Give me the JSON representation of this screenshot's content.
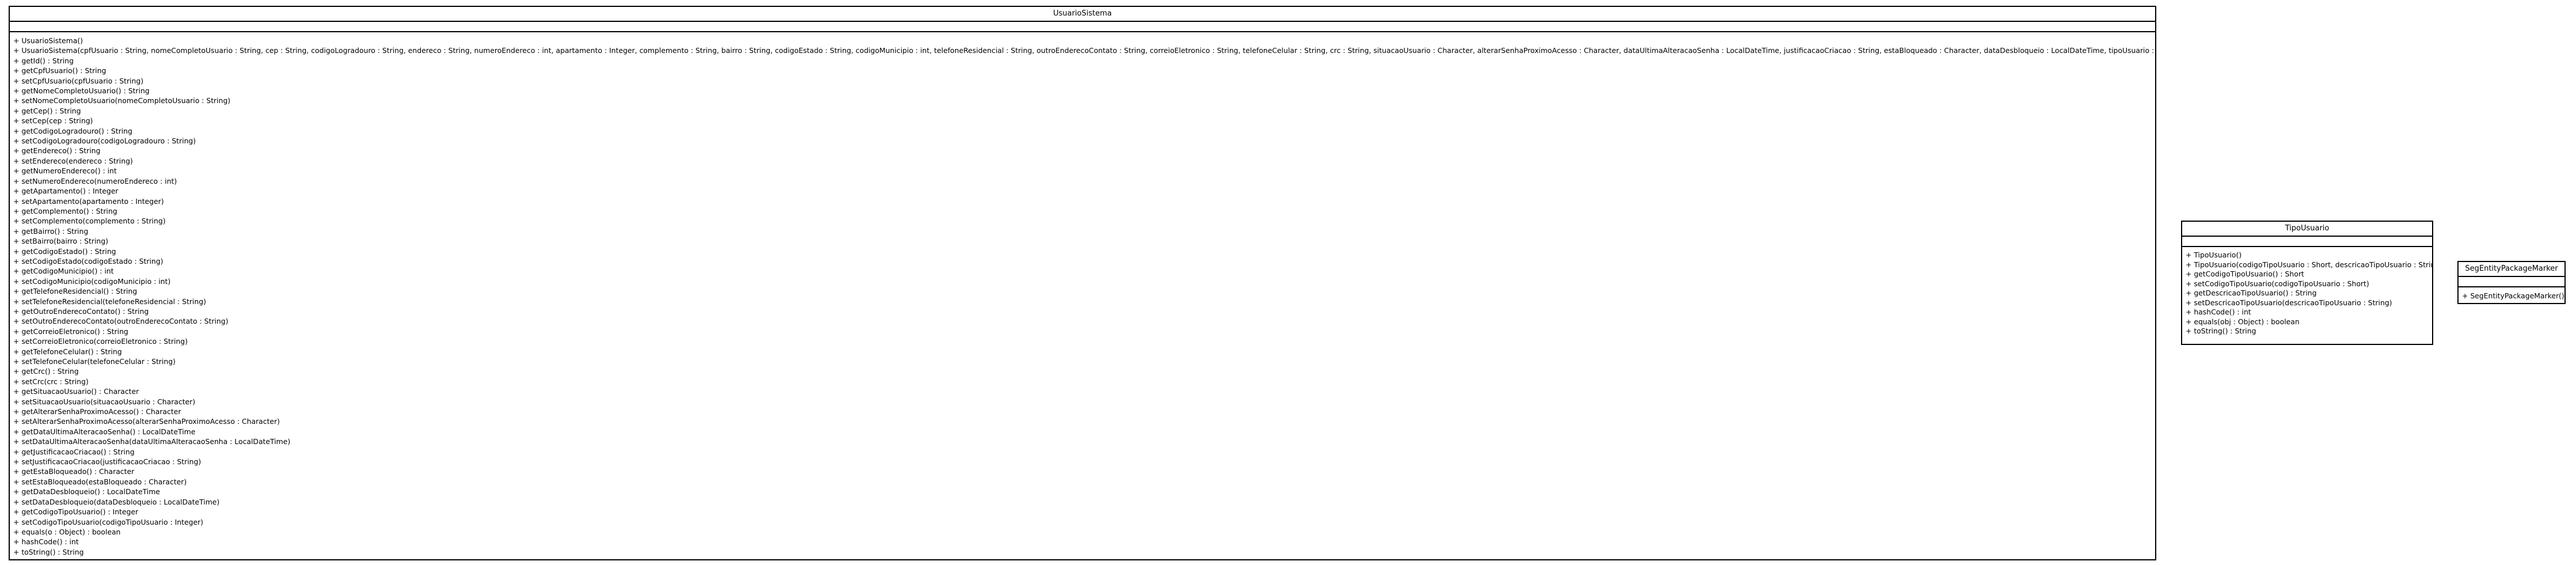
{
  "classes": {
    "usuario_sistema": {
      "name": "UsuarioSistema",
      "operations": [
        "+ UsuarioSistema()",
        "+ UsuarioSistema(cpfUsuario : String, nomeCompletoUsuario : String, cep : String, codigoLogradouro : String, endereco : String, numeroEndereco : int, apartamento : Integer, complemento : String, bairro : String, codigoEstado : String, codigoMunicipio : int, telefoneResidencial : String, outroEnderecoContato : String, correioEletronico : String, telefoneCelular : String, crc : String, situacaoUsuario : Character, alterarSenhaProximoAcesso : Character, dataUltimaAlteracaoSenha : LocalDateTime, justificacaoCriacao : String, estaBloqueado : Character, dataDesbloqueio : LocalDateTime, tipoUsuario : TipoUsuario, codigoTipoUsuario : Integer)",
        "+ getId() : String",
        "+ getCpfUsuario() : String",
        "+ setCpfUsuario(cpfUsuario : String)",
        "+ getNomeCompletoUsuario() : String",
        "+ setNomeCompletoUsuario(nomeCompletoUsuario : String)",
        "+ getCep() : String",
        "+ setCep(cep : String)",
        "+ getCodigoLogradouro() : String",
        "+ setCodigoLogradouro(codigoLogradouro : String)",
        "+ getEndereco() : String",
        "+ setEndereco(endereco : String)",
        "+ getNumeroEndereco() : int",
        "+ setNumeroEndereco(numeroEndereco : int)",
        "+ getApartamento() : Integer",
        "+ setApartamento(apartamento : Integer)",
        "+ getComplemento() : String",
        "+ setComplemento(complemento : String)",
        "+ getBairro() : String",
        "+ setBairro(bairro : String)",
        "+ getCodigoEstado() : String",
        "+ setCodigoEstado(codigoEstado : String)",
        "+ getCodigoMunicipio() : int",
        "+ setCodigoMunicipio(codigoMunicipio : int)",
        "+ getTelefoneResidencial() : String",
        "+ setTelefoneResidencial(telefoneResidencial : String)",
        "+ getOutroEnderecoContato() : String",
        "+ setOutroEnderecoContato(outroEnderecoContato : String)",
        "+ getCorreioEletronico() : String",
        "+ setCorreioEletronico(correioEletronico : String)",
        "+ getTelefoneCelular() : String",
        "+ setTelefoneCelular(telefoneCelular : String)",
        "+ getCrc() : String",
        "+ setCrc(crc : String)",
        "+ getSituacaoUsuario() : Character",
        "+ setSituacaoUsuario(situacaoUsuario : Character)",
        "+ getAlterarSenhaProximoAcesso() : Character",
        "+ setAlterarSenhaProximoAcesso(alterarSenhaProximoAcesso : Character)",
        "+ getDataUltimaAlteracaoSenha() : LocalDateTime",
        "+ setDataUltimaAlteracaoSenha(dataUltimaAlteracaoSenha : LocalDateTime)",
        "+ getJustificacaoCriacao() : String",
        "+ setJustificacaoCriacao(justificacaoCriacao : String)",
        "+ getEstaBloqueado() : Character",
        "+ setEstaBloqueado(estaBloqueado : Character)",
        "+ getDataDesbloqueio() : LocalDateTime",
        "+ setDataDesbloqueio(dataDesbloqueio : LocalDateTime)",
        "+ getCodigoTipoUsuario() : Integer",
        "+ setCodigoTipoUsuario(codigoTipoUsuario : Integer)",
        "+ equals(o : Object) : boolean",
        "+ hashCode() : int",
        "+ toString() : String"
      ]
    },
    "tipo_usuario": {
      "name": "TipoUsuario",
      "operations": [
        "+ TipoUsuario()",
        "+ TipoUsuario(codigoTipoUsuario : Short, descricaoTipoUsuario : String)",
        "+ getCodigoTipoUsuario() : Short",
        "+ setCodigoTipoUsuario(codigoTipoUsuario : Short)",
        "+ getDescricaoTipoUsuario() : String",
        "+ setDescricaoTipoUsuario(descricaoTipoUsuario : String)",
        "+ hashCode() : int",
        "+ equals(obj : Object) : boolean",
        "+ toString() : String"
      ]
    },
    "seg_entity_package_marker": {
      "name": "SegEntityPackageMarker",
      "operations": [
        "+ SegEntityPackageMarker()"
      ]
    }
  }
}
